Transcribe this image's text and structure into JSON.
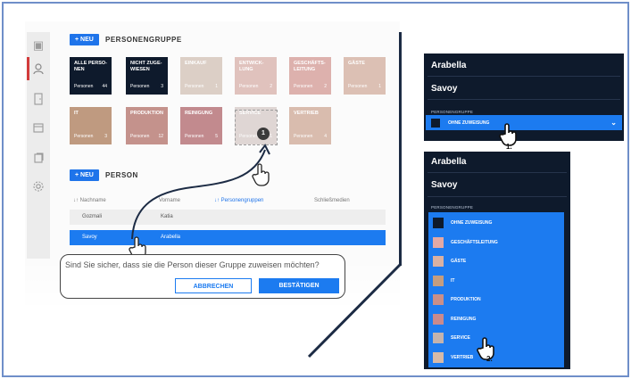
{
  "person_groups": {
    "add_label": "+ NEU",
    "title": "PERSONENGRUPPE",
    "tiles": [
      {
        "name_line1": "ALLE PERSO-",
        "name_line2": "NEN",
        "label": "Personen",
        "count": "44",
        "color": "#0e1a2c"
      },
      {
        "name_line1": "NICHT ZUGE-",
        "name_line2": "WIESEN",
        "label": "Personen",
        "count": "3",
        "color": "#0e1a2c"
      },
      {
        "name_line1": "EINKAUF",
        "name_line2": "",
        "label": "Personen",
        "count": "1",
        "color": "#dccfc6"
      },
      {
        "name_line1": "ENTWICK-",
        "name_line2": "LUNG",
        "label": "Personen",
        "count": "2",
        "color": "#e0c2bd"
      },
      {
        "name_line1": "GESCHÄFTS-",
        "name_line2": "LEITUNG",
        "label": "Personen",
        "count": "2",
        "color": "#ddb1ad"
      },
      {
        "name_line1": "GÄSTE",
        "name_line2": "",
        "label": "Personen",
        "count": "1",
        "color": "#dcc0b4"
      },
      {
        "name_line1": "IT",
        "name_line2": "",
        "label": "Personen",
        "count": "3",
        "color": "#bf9a80"
      },
      {
        "name_line1": "PRODUKTION",
        "name_line2": "",
        "label": "Personen",
        "count": "12",
        "color": "#c4928c"
      },
      {
        "name_line1": "REINIGUNG",
        "name_line2": "",
        "label": "Personen",
        "count": "5",
        "color": "#c28a8e"
      },
      {
        "name_line1": "SERVICE",
        "name_line2": "",
        "label": "Personen",
        "count": "1",
        "color": "#c9b9b5"
      },
      {
        "name_line1": "VERTRIEB",
        "name_line2": "",
        "label": "Personen",
        "count": "4",
        "color": "#d9bcae"
      }
    ],
    "drag_badge": "1"
  },
  "person_section": {
    "add_label": "+ NEU",
    "title": "PERSON",
    "columns": [
      "↓↑ Nachname",
      "Vorname",
      "↓↑ Personengruppen",
      "Schließmedien"
    ],
    "rows": [
      {
        "last_name": "Gozmali",
        "first_name": "Katia"
      },
      {
        "last_name": "Savoy",
        "first_name": "Arabella"
      }
    ]
  },
  "confirm_dialog": {
    "message": "Sind Sie sicher, dass sie die Person dieser Gruppe zuweisen möchten?",
    "cancel_label": "ABBRECHEN",
    "confirm_label": "BESTÄTIGEN"
  },
  "detail_panel_1": {
    "first_name": "Arabella",
    "last_name": "Savoy",
    "group_label": "PERSONENGRUPPE",
    "selected_value": "OHNE ZUWEISUNG",
    "step_label": "1."
  },
  "detail_panel_2": {
    "first_name": "Arabella",
    "last_name": "Savoy",
    "group_label": "PERSONENGRUPPE",
    "options": [
      {
        "label": "OHNE ZUWEISUNG",
        "color": "#0e1a2c"
      },
      {
        "label": "GESCHÄFTSLEITUNG",
        "color": "#e3a9a5"
      },
      {
        "label": "GÄSTE",
        "color": "#d9b1a3"
      },
      {
        "label": "IT",
        "color": "#c49d80"
      },
      {
        "label": "PRODUKTION",
        "color": "#c98f89"
      },
      {
        "label": "REINIGUNG",
        "color": "#c98a8d"
      },
      {
        "label": "SERVICE",
        "color": "#c4b3ae"
      },
      {
        "label": "VERTRIEB",
        "color": "#d7baa8"
      }
    ],
    "step_label": "2."
  },
  "colors": {
    "accent": "#1f74ea",
    "dark_navy": "#0e1a2c",
    "dropdown_blue": "#1c7bf0"
  }
}
